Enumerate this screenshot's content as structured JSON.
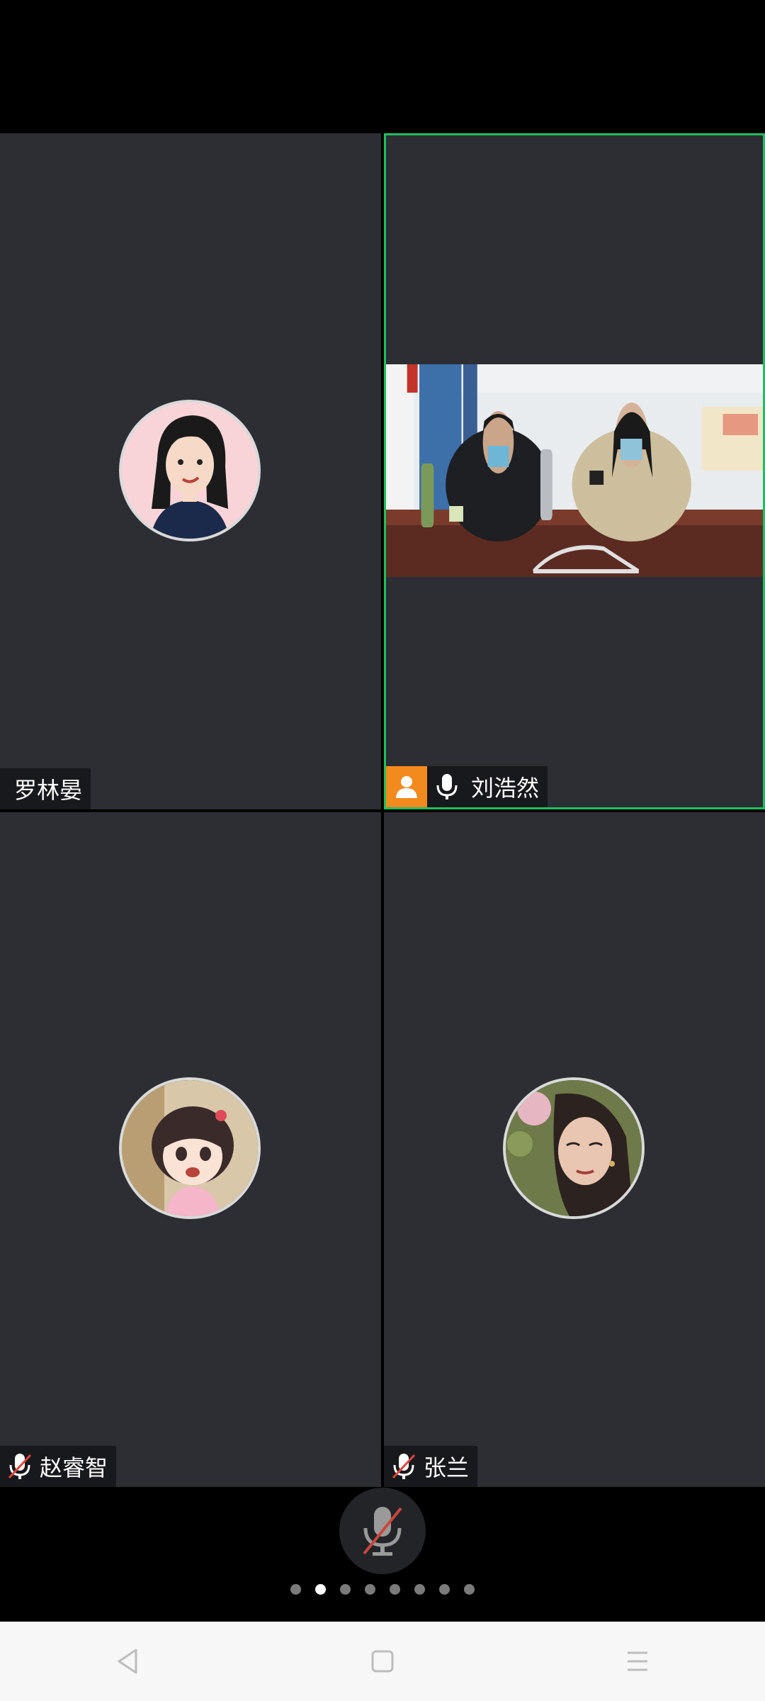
{
  "participants": [
    {
      "name": "罗林晏",
      "muted_icon": false,
      "mic_icon": false,
      "host": false
    },
    {
      "name": "刘浩然",
      "muted_icon": false,
      "mic_icon": true,
      "host": true,
      "active_speaker": true,
      "video_on": true
    },
    {
      "name": "赵睿智",
      "muted_icon": true,
      "mic_icon": false,
      "host": false
    },
    {
      "name": "张兰",
      "muted_icon": true,
      "mic_icon": false,
      "host": false
    }
  ],
  "controls": {
    "mic_state": "muted",
    "page_count": 8,
    "current_page": 2
  },
  "colors": {
    "tile_bg": "#2c2e33",
    "active_border": "#1fbf5f",
    "host_badge": "#f28a1d",
    "muted_slash": "#e0463c"
  },
  "icons": {
    "host": "person-icon",
    "mic": "microphone-icon",
    "muted": "microphone-muted-icon",
    "nav": [
      "back-triangle-icon",
      "home-square-icon",
      "recents-menu-icon"
    ]
  }
}
